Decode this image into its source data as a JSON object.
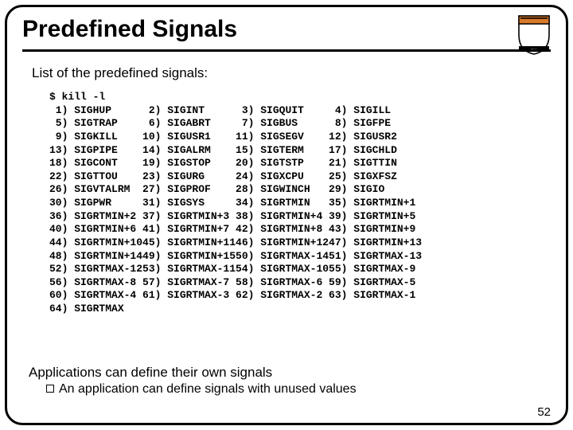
{
  "title": "Predefined Signals",
  "intro": "List of the predefined signals:",
  "command": "$ kill -l",
  "signals": [
    {
      "n": 1,
      "name": "SIGHUP"
    },
    {
      "n": 2,
      "name": "SIGINT"
    },
    {
      "n": 3,
      "name": "SIGQUIT"
    },
    {
      "n": 4,
      "name": "SIGILL"
    },
    {
      "n": 5,
      "name": "SIGTRAP"
    },
    {
      "n": 6,
      "name": "SIGABRT"
    },
    {
      "n": 7,
      "name": "SIGBUS"
    },
    {
      "n": 8,
      "name": "SIGFPE"
    },
    {
      "n": 9,
      "name": "SIGKILL"
    },
    {
      "n": 10,
      "name": "SIGUSR1"
    },
    {
      "n": 11,
      "name": "SIGSEGV"
    },
    {
      "n": 12,
      "name": "SIGUSR2"
    },
    {
      "n": 13,
      "name": "SIGPIPE"
    },
    {
      "n": 14,
      "name": "SIGALRM"
    },
    {
      "n": 15,
      "name": "SIGTERM"
    },
    {
      "n": 17,
      "name": "SIGCHLD"
    },
    {
      "n": 18,
      "name": "SIGCONT"
    },
    {
      "n": 19,
      "name": "SIGSTOP"
    },
    {
      "n": 20,
      "name": "SIGTSTP"
    },
    {
      "n": 21,
      "name": "SIGTTIN"
    },
    {
      "n": 22,
      "name": "SIGTTOU"
    },
    {
      "n": 23,
      "name": "SIGURG"
    },
    {
      "n": 24,
      "name": "SIGXCPU"
    },
    {
      "n": 25,
      "name": "SIGXFSZ"
    },
    {
      "n": 26,
      "name": "SIGVTALRM"
    },
    {
      "n": 27,
      "name": "SIGPROF"
    },
    {
      "n": 28,
      "name": "SIGWINCH"
    },
    {
      "n": 29,
      "name": "SIGIO"
    },
    {
      "n": 30,
      "name": "SIGPWR"
    },
    {
      "n": 31,
      "name": "SIGSYS"
    },
    {
      "n": 34,
      "name": "SIGRTMIN"
    },
    {
      "n": 35,
      "name": "SIGRTMIN+1"
    },
    {
      "n": 36,
      "name": "SIGRTMIN+2"
    },
    {
      "n": 37,
      "name": "SIGRTMIN+3"
    },
    {
      "n": 38,
      "name": "SIGRTMIN+4"
    },
    {
      "n": 39,
      "name": "SIGRTMIN+5"
    },
    {
      "n": 40,
      "name": "SIGRTMIN+6"
    },
    {
      "n": 41,
      "name": "SIGRTMIN+7"
    },
    {
      "n": 42,
      "name": "SIGRTMIN+8"
    },
    {
      "n": 43,
      "name": "SIGRTMIN+9"
    },
    {
      "n": 44,
      "name": "SIGRTMIN+10"
    },
    {
      "n": 45,
      "name": "SIGRTMIN+11"
    },
    {
      "n": 46,
      "name": "SIGRTMIN+12"
    },
    {
      "n": 47,
      "name": "SIGRTMIN+13"
    },
    {
      "n": 48,
      "name": "SIGRTMIN+14"
    },
    {
      "n": 49,
      "name": "SIGRTMIN+15"
    },
    {
      "n": 50,
      "name": "SIGRTMAX-14"
    },
    {
      "n": 51,
      "name": "SIGRTMAX-13"
    },
    {
      "n": 52,
      "name": "SIGRTMAX-12"
    },
    {
      "n": 53,
      "name": "SIGRTMAX-11"
    },
    {
      "n": 54,
      "name": "SIGRTMAX-10"
    },
    {
      "n": 55,
      "name": "SIGRTMAX-9"
    },
    {
      "n": 56,
      "name": "SIGRTMAX-8"
    },
    {
      "n": 57,
      "name": "SIGRTMAX-7"
    },
    {
      "n": 58,
      "name": "SIGRTMAX-6"
    },
    {
      "n": 59,
      "name": "SIGRTMAX-5"
    },
    {
      "n": 60,
      "name": "SIGRTMAX-4"
    },
    {
      "n": 61,
      "name": "SIGRTMAX-3"
    },
    {
      "n": 62,
      "name": "SIGRTMAX-2"
    },
    {
      "n": 63,
      "name": "SIGRTMAX-1"
    },
    {
      "n": 64,
      "name": "SIGRTMAX"
    }
  ],
  "footer_line1": "Applications can define their own signals",
  "footer_line2": "An application can define signals with unused values",
  "page_num": "52",
  "colors": {
    "logo_orange": "#d97a2a",
    "logo_black": "#000"
  }
}
